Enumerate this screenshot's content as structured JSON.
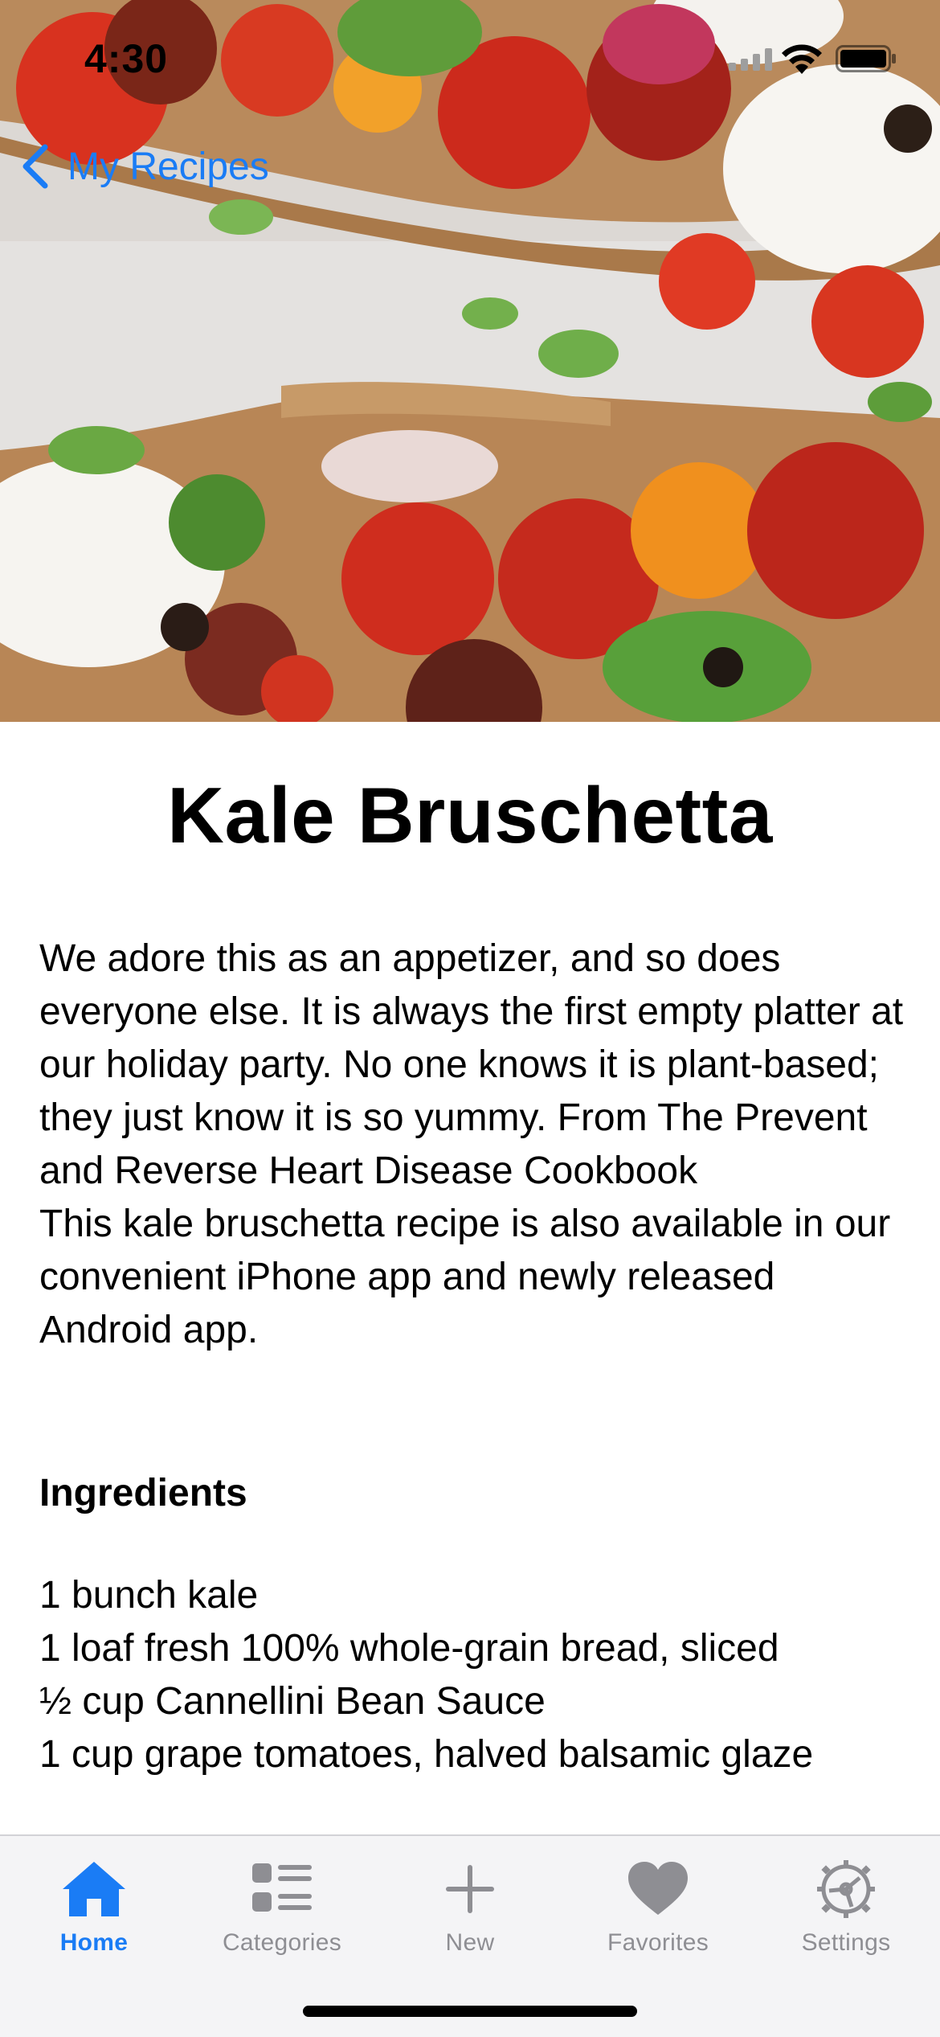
{
  "status_bar": {
    "time": "4:30"
  },
  "nav": {
    "back_label": "My Recipes",
    "back_icon": "chevron-left-icon",
    "accent_color": "#1a7cf5"
  },
  "recipe": {
    "title": "Kale Bruschetta",
    "description": [
      "We adore this as an appetizer, and so does everyone else. It is always the first empty platter at our holiday party. No one knows it is plant-based; they just know it is so yummy. From The Prevent and Reverse Heart Disease Cookbook",
      "This kale bruschetta recipe is also available in our convenient iPhone app and newly released Android app."
    ],
    "ingredients_heading": "Ingredients",
    "ingredients": [
      "1 bunch kale",
      "1 loaf fresh 100% whole-grain bread, sliced",
      "½ cup Cannellini Bean Sauce",
      "1 cup grape tomatoes, halved balsamic glaze"
    ]
  },
  "tab_bar": {
    "tabs": [
      {
        "label": "Home",
        "icon": "house-icon",
        "active": true
      },
      {
        "label": "Categories",
        "icon": "list-icon",
        "active": false
      },
      {
        "label": "New",
        "icon": "plus-icon",
        "active": false
      },
      {
        "label": "Favorites",
        "icon": "heart-icon",
        "active": false
      },
      {
        "label": "Settings",
        "icon": "gear-icon",
        "active": false
      }
    ],
    "active_color": "#1a7cf5",
    "inactive_color": "#8e8e93"
  }
}
